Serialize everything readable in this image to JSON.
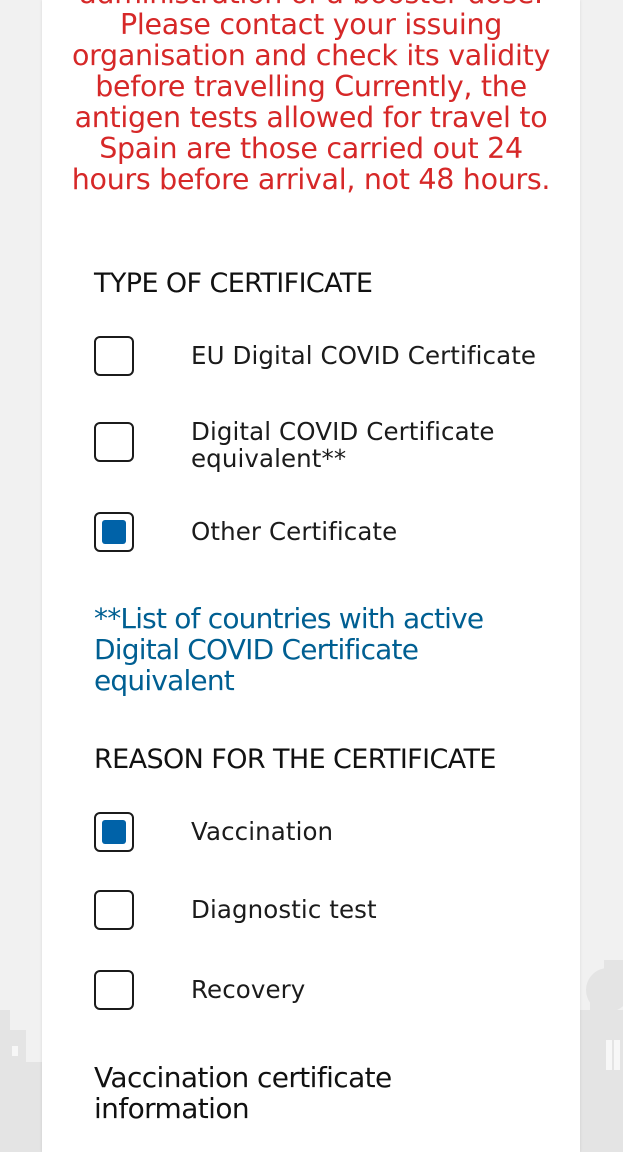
{
  "warning": {
    "partial_line": "administration of a booster dose.",
    "text": "Please contact your issuing organisation and check its validity before travelling Currently, the antigen tests allowed for travel to Spain are those carried out 24 hours before arrival, not 48 hours."
  },
  "type_of_certificate": {
    "title": "TYPE OF CERTIFICATE",
    "options": [
      {
        "label": "EU Digital COVID Certificate",
        "checked": false
      },
      {
        "label": "Digital COVID Certificate equivalent**",
        "checked": false
      },
      {
        "label": "Other Certificate",
        "checked": true
      }
    ]
  },
  "countries_link": {
    "text": "**List of countries with active Digital COVID Certificate equivalent"
  },
  "reason_for_certificate": {
    "title": "REASON FOR THE CERTIFICATE",
    "options": [
      {
        "label": "Vaccination",
        "checked": true
      },
      {
        "label": "Diagnostic test",
        "checked": false
      },
      {
        "label": "Recovery",
        "checked": false
      }
    ]
  },
  "vaccination_info": {
    "title": "Vaccination certificate information"
  },
  "colors": {
    "warning_red": "#d62828",
    "link_blue": "#005f92",
    "checkbox_fill_blue": "#0062a8",
    "background_gray": "#f1f1f1"
  }
}
